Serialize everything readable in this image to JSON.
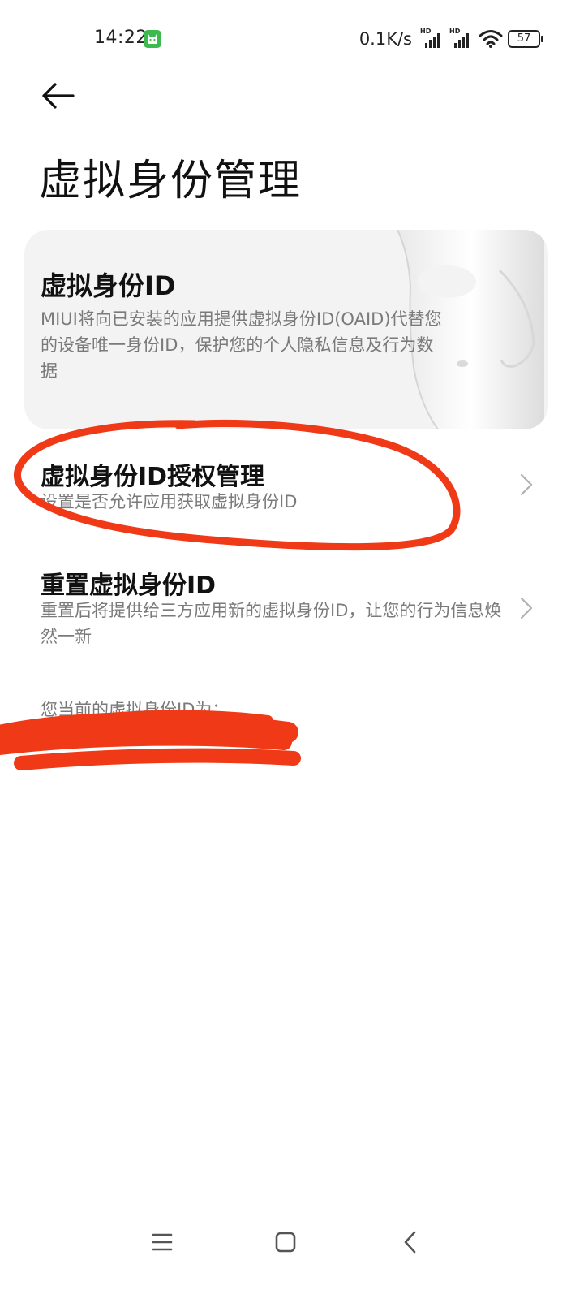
{
  "status_bar": {
    "time": "14:22",
    "net_speed": "0.1K/s",
    "signal_tag": "HD",
    "battery": "57",
    "icons": [
      "android-notification-icon",
      "signal-hd-icon",
      "signal-hd-icon",
      "wifi-icon",
      "battery-icon"
    ]
  },
  "header": {
    "back_icon": "arrow-left-icon",
    "title": "虚拟身份管理"
  },
  "info_card": {
    "title": "虚拟身份ID",
    "description": "MIUI将向已安装的应用提供虚拟身份ID(OAID)代替您的设备唯一身份ID，保护您的个人隐私信息及行为数据",
    "illustration": "mask-illustration"
  },
  "items": [
    {
      "title": "虚拟身份ID授权管理",
      "subtitle": "设置是否允许应用获取虚拟身份ID",
      "icon": "chevron-right-icon"
    },
    {
      "title": "重置虚拟身份ID",
      "subtitle": "重置后将提供给三方应用新的虚拟身份ID，让您的行为信息焕然一新",
      "icon": "chevron-right-icon"
    }
  ],
  "current_id": {
    "label": "您当前的虚拟身份ID为："
  },
  "annotation": {
    "color": "#f03a17"
  },
  "nav_bar": {
    "icons": [
      "menu-icon",
      "home-icon",
      "back-icon"
    ]
  }
}
